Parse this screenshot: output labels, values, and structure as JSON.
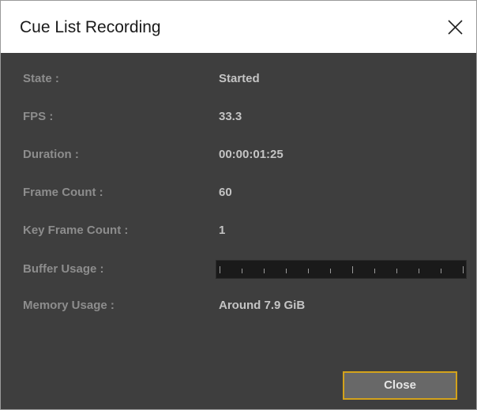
{
  "window": {
    "title": "Cue List Recording",
    "close_icon": "close-icon"
  },
  "fields": [
    {
      "label": "State :",
      "value": "Started"
    },
    {
      "label": "FPS :",
      "value": "33.3"
    },
    {
      "label": "Duration :",
      "value": "00:00:01:25"
    },
    {
      "label": "Frame Count :",
      "value": "60"
    },
    {
      "label": "Key Frame Count :",
      "value": "1"
    },
    {
      "label": "Buffer Usage :",
      "value": ""
    },
    {
      "label": "Memory Usage :",
      "value": "Around 7.9 GiB"
    }
  ],
  "buffer_usage": {
    "fraction": 0.0,
    "tick_count": 12
  },
  "buttons": {
    "close_label": "Close"
  },
  "colors": {
    "panel_background": "#3e3e3e",
    "label_text": "#8d8d8d",
    "value_text": "#c4c4c4",
    "button_border": "#d3a21b",
    "button_background": "#686868"
  }
}
